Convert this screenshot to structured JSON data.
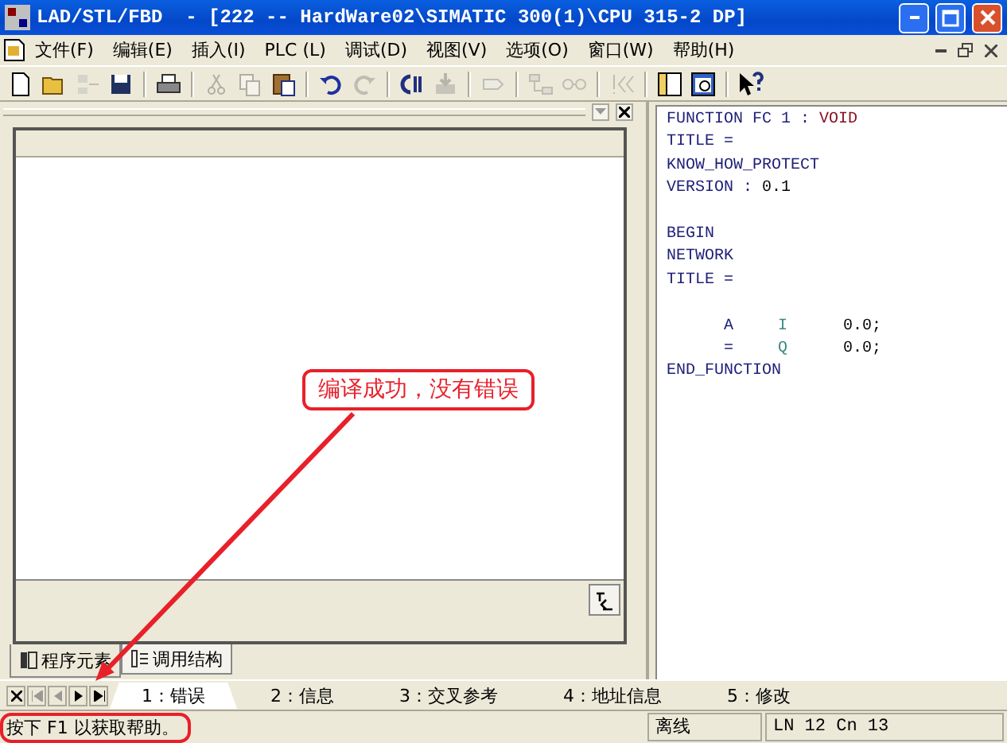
{
  "window": {
    "title": "LAD/STL/FBD  - [222 -- HardWare02\\SIMATIC 300(1)\\CPU 315-2 DP]"
  },
  "menu": [
    {
      "label": "文件(F)"
    },
    {
      "label": "编辑(E)"
    },
    {
      "label": "插入(I)"
    },
    {
      "label": "PLC (L)"
    },
    {
      "label": "调试(D)"
    },
    {
      "label": "视图(V)"
    },
    {
      "label": "选项(O)"
    },
    {
      "label": "窗口(W)"
    },
    {
      "label": "帮助(H)"
    }
  ],
  "toolbar": [
    {
      "kind": "new",
      "disabled": false
    },
    {
      "kind": "open",
      "disabled": false
    },
    {
      "kind": "access",
      "disabled": true
    },
    {
      "kind": "save",
      "disabled": false
    },
    {
      "kind": "sep"
    },
    {
      "kind": "print",
      "disabled": false
    },
    {
      "kind": "sep"
    },
    {
      "kind": "cut",
      "disabled": true
    },
    {
      "kind": "copy",
      "disabled": true
    },
    {
      "kind": "paste",
      "disabled": false
    },
    {
      "kind": "sep"
    },
    {
      "kind": "undo",
      "disabled": false
    },
    {
      "kind": "redo",
      "disabled": true
    },
    {
      "kind": "sep"
    },
    {
      "kind": "compile",
      "disabled": false
    },
    {
      "kind": "download",
      "disabled": true
    },
    {
      "kind": "sep"
    },
    {
      "kind": "tag",
      "disabled": true
    },
    {
      "kind": "sep"
    },
    {
      "kind": "network",
      "disabled": true
    },
    {
      "kind": "glasses",
      "disabled": true
    },
    {
      "kind": "sep"
    },
    {
      "kind": "jump",
      "disabled": true
    },
    {
      "kind": "sep"
    },
    {
      "kind": "panel",
      "disabled": false
    },
    {
      "kind": "preview",
      "disabled": false
    },
    {
      "kind": "sep"
    },
    {
      "kind": "help",
      "disabled": false
    }
  ],
  "left_panel": {
    "tabs": [
      {
        "label": "程序元素",
        "selected": true
      },
      {
        "label": "调用结构",
        "selected": false
      }
    ]
  },
  "code": [
    {
      "indented": false,
      "spaced": false,
      "tokens": [
        {
          "kind": "keyword",
          "text": "FUNCTION FC 1 : "
        },
        {
          "kind": "type",
          "text": "VOID"
        }
      ]
    },
    {
      "indented": false,
      "spaced": false,
      "tokens": [
        {
          "kind": "keyword",
          "text": "TITLE ="
        }
      ]
    },
    {
      "indented": false,
      "spaced": false,
      "tokens": [
        {
          "kind": "keyword",
          "text": "KNOW_HOW_PROTECT"
        }
      ]
    },
    {
      "indented": false,
      "spaced": false,
      "tokens": [
        {
          "kind": "keyword",
          "text": "VERSION : "
        },
        {
          "kind": "plain",
          "text": "0.1"
        }
      ]
    },
    {
      "indented": false,
      "spaced": true,
      "tokens": [
        {
          "kind": "keyword",
          "text": "BEGIN"
        }
      ]
    },
    {
      "indented": false,
      "spaced": false,
      "tokens": [
        {
          "kind": "keyword",
          "text": "NETWORK"
        }
      ]
    },
    {
      "indented": false,
      "spaced": false,
      "tokens": [
        {
          "kind": "keyword",
          "text": "TITLE ="
        }
      ]
    },
    {
      "indented": true,
      "spaced": true,
      "tokens": [
        {
          "kind": "keyword",
          "text": "A"
        },
        {
          "kind": "operand",
          "text": "I"
        },
        {
          "kind": "plain",
          "text": "0.0;"
        }
      ]
    },
    {
      "indented": true,
      "spaced": false,
      "tokens": [
        {
          "kind": "keyword",
          "text": "="
        },
        {
          "kind": "operand",
          "text": "Q"
        },
        {
          "kind": "plain",
          "text": "0.0;"
        }
      ]
    },
    {
      "indented": false,
      "spaced": false,
      "tokens": [
        {
          "kind": "keyword",
          "text": "END_FUNCTION"
        }
      ]
    }
  ],
  "detail_tabs": [
    {
      "label": "1：错误",
      "selected": true
    },
    {
      "label": "2：信息",
      "selected": false
    },
    {
      "label": "3：交叉参考",
      "selected": false
    },
    {
      "label": "4：地址信息",
      "selected": false
    },
    {
      "label": "5：修改",
      "selected": false
    }
  ],
  "status_bar": {
    "hint": "按下 F1 以获取帮助。",
    "mode": "离线",
    "position": "LN 12 Cn 13"
  },
  "annotation": {
    "text": "编译成功，没有错误"
  }
}
